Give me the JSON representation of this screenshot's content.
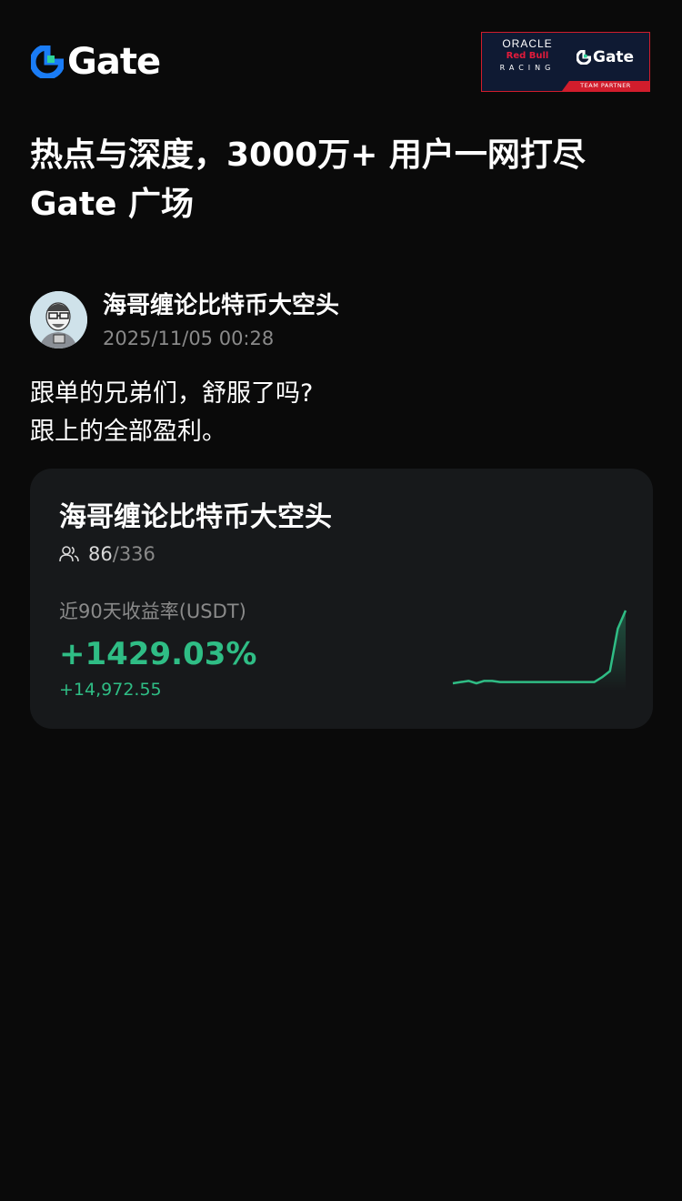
{
  "brand": {
    "logo_text": "Gate"
  },
  "partner": {
    "oracle": "ORACLE",
    "redbull": "Red Bull",
    "racing": "RACING",
    "gate": "Gate",
    "strip": "TEAM PARTNER"
  },
  "headline": {
    "line1": "热点与深度，3000万+ 用户一网打尽",
    "line2": "Gate 广场"
  },
  "post": {
    "author": "海哥缠论比特币大空头",
    "time": "2025/11/05 00:28",
    "lines": [
      "跟单的兄弟们，舒服了吗?",
      "跟上的全部盈利。"
    ]
  },
  "card": {
    "title": "海哥缠论比特币大空头",
    "followers_current": "86",
    "followers_separator": "/",
    "followers_max": "336",
    "metric_label": "近90天收益率(USDT)",
    "metric_value": "+1429.03%",
    "metric_sub": "+14,972.55",
    "accent_color": "#2fbd85"
  },
  "chart_data": {
    "type": "line",
    "series": [
      {
        "values": [
          0,
          1,
          2,
          0,
          2,
          2,
          1,
          1,
          1,
          1,
          1,
          1,
          1,
          1,
          1,
          1,
          1,
          1,
          1,
          5,
          10,
          45,
          60
        ]
      }
    ]
  }
}
